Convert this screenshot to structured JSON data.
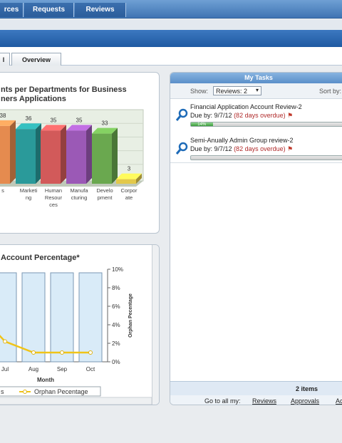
{
  "nav": {
    "items": [
      "rces",
      "Requests",
      "Reviews"
    ]
  },
  "tabs": [
    {
      "label": "l"
    },
    {
      "label": "Overview"
    }
  ],
  "chart1": {
    "title_line1": "nts per Departments for Business",
    "title_line2": "ners Applications"
  },
  "chart_data": [
    {
      "type": "bar",
      "title": "nts per Departments for Business ners Applications",
      "categories": [
        "s",
        "Marketing",
        "Human Resources",
        "Manufacturing",
        "Development",
        "Corporate"
      ],
      "category_labels": [
        "s",
        "Marketi\nng",
        "Human\nResour\nces",
        "Manufa\ncturing",
        "Develo\npment",
        "Corpor\nate"
      ],
      "values": [
        38,
        36,
        35,
        35,
        33,
        3
      ],
      "colors": [
        "#e58b4f",
        "#2a9a9a",
        "#d25a5a",
        "#9b59b6",
        "#6aa84f",
        "#e3c94a"
      ]
    },
    {
      "type": "line",
      "title": "Account Percentage*",
      "xlabel": "Month",
      "ylabel": "Orphan Pecentage",
      "categories": [
        "Jul",
        "Aug",
        "Sep",
        "Oct"
      ],
      "y_ticks": [
        "10%",
        "8%",
        "6%",
        "4%",
        "2%",
        "0%"
      ],
      "ylim": [
        0,
        10
      ],
      "series": [
        {
          "name": "Orphan Pecentage",
          "values": [
            2.2,
            1.0,
            1.0,
            1.0
          ]
        }
      ],
      "legend_partial": "s"
    }
  ],
  "tasks": {
    "header": "My Tasks",
    "show_label": "Show:",
    "show_value": "Reviews: 2",
    "sort_label": "Sort by:",
    "items": [
      {
        "title": "Financial Application Account Review-2",
        "due": "Due by: 9/7/12",
        "overdue": "(82 days overdue)",
        "progress": "14%",
        "progress_value": 14
      },
      {
        "title": "Semi-Anually Admin Group review-2",
        "due": "Due by: 9/7/12",
        "overdue": "(82 days overdue)",
        "progress": "",
        "progress_value": 0
      }
    ],
    "count": "2 items",
    "goto_label": "Go to all my:",
    "links": [
      "Reviews",
      "Approvals",
      "Ac"
    ]
  },
  "colors": {
    "nav": "#3f74b3",
    "accent_blue": "#1f5aa2",
    "overdue": "#b02a2a",
    "progress": "#3c9b3c"
  }
}
